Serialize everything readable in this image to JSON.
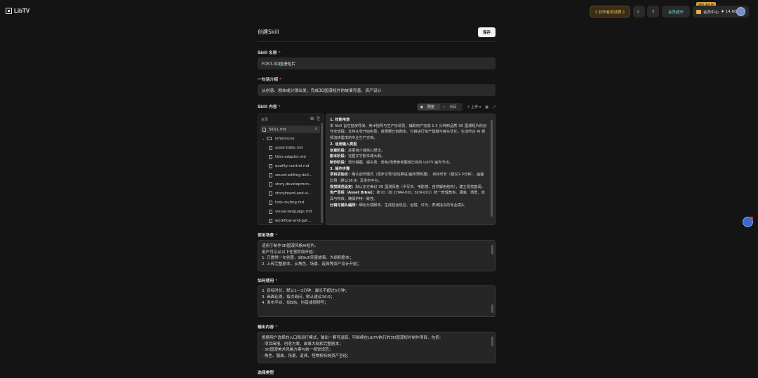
{
  "header": {
    "logo_text": "LibTV",
    "challenge_label": "《 创作者挑战赛 》",
    "member_label": "会员超市",
    "limited_badge": "限时 3折 热",
    "center_label": "会员中心",
    "credits": "♦ 14,609"
  },
  "page": {
    "title": "创建Skill",
    "save_label": "保存"
  },
  "skill_name": {
    "label": "Skill 名称",
    "value": "FOST-3D国漫短片"
  },
  "intro": {
    "label": "一句话介绍",
    "value": "从创意、剧本或分镜出发，完成3D国漫短片的故事完善、资产设计"
  },
  "content": {
    "label": "Skill 内容",
    "view_preview": "预览",
    "view_code": "代码",
    "upload_label": "上传",
    "tree_title": "目录",
    "tree_items": [
      {
        "name": "SKILL.md",
        "badge": "8"
      },
      {
        "name": "references"
      },
      {
        "name": "asset-bible.md"
      },
      {
        "name": "libtv-adapter.md"
      },
      {
        "name": "quality-control.md"
      },
      {
        "name": "sound-editing-deli..."
      },
      {
        "name": "story-developmen..."
      },
      {
        "name": "storyboard-and-vi..."
      },
      {
        "name": "tool-routing.md"
      },
      {
        "name": "visual-language.md"
      },
      {
        "name": "workflow-and-gat..."
      }
    ],
    "preview_lines": [
      {
        "kind": "h",
        "text": "1. 技能用途"
      },
      {
        "kind": "p",
        "text": "本 Skill 旨在担演导演、美术指导与生产协调员，辅助用户完成 1-5 分钟商品质 3D 国漫短片的创作全流程。支持从零开始构思，或根据已有剧本、分镜进行资产建模与镜头优化，生成符合 AI 视频流转需求的专业生产文档。"
      },
      {
        "kind": "h",
        "text": "2. 适用输入类型"
      },
      {
        "kind": "kv",
        "key": "创意阶段：",
        "text": "故事简介或核心想法。"
      },
      {
        "kind": "kv",
        "key": "剧本阶段：",
        "text": "完整文字剧本或大纲。"
      },
      {
        "kind": "kv",
        "key": "制作阶段：",
        "text": "现分镜图、镜头表、角色/场景参考图或已有的 LibTV 画布节点。"
      },
      {
        "kind": "h",
        "text": "3. 操作步骤"
      },
      {
        "kind": "kv",
        "key": "项目初始化：",
        "text": "确认创作模式（逐步引导/自动推进/画布预构建）、目标时长（建议1-3分钟）、画面比例（默认16:9）及发布平台。"
      },
      {
        "kind": "kv",
        "key": "视觉规范设定：",
        "text": "默认东方美幻 3D 国漫风格（半写实、电影感、自然解剖结构），建立视觉基调。"
      },
      {
        "kind": "kv",
        "key": "资产圣经（Asset Bible）：",
        "text": "按 ID（如 CHAR-001, SCN-001）统一管理角色、服装、场景、道具与特效，确保护持一致性。"
      },
      {
        "kind": "kv",
        "key": "分镜与镜头编排：",
        "text": "细化分镜脚本，生成包含机位、运镜、灯光、表演指令的专业镜头"
      }
    ]
  },
  "scenario": {
    "label": "使用场景",
    "lines": [
      "适用于制作3D国漫风格AI短片。",
      "用户可以从以下任意阶段开始：",
      "1. 只提供一句创意，由Skill完善故事、大纲和剧本；",
      "2. 上传完整剧本，从角色、场景、道具等资产设计开始；"
    ]
  },
  "howto": {
    "label": "如何使用",
    "lines": [
      "2. 目标时长，默认1—3分钟，最长不超过5分钟；",
      "3. 画面比例，每次询问，默认建议16:9；",
      "4. 发布平台，如B站、抖音或视频号；"
    ]
  },
  "output": {
    "label": "输出内容",
    "lines": [
      "根据用户选择的入口和运行模式，输出一套可追踪、可继续在LibTV执行的3D国漫短片制作项目，包括：",
      "- 项目简报、创意方案、故事大纲和完整剧本；",
      "- 3D国漫美术风格方案与统一视觉规范；",
      "- 角色、服装、场景、道具、怪物和特效资产圣经；"
    ]
  },
  "select_type": {
    "label": "选择类型"
  }
}
